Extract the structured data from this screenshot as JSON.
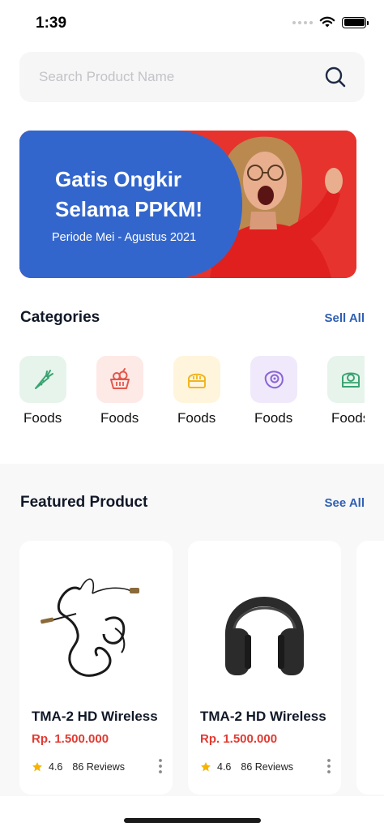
{
  "status_bar": {
    "time": "1:39"
  },
  "search": {
    "placeholder": "Search Product Name"
  },
  "banner": {
    "title": "Gatis Ongkir Selama PPKM!",
    "subtitle": "Periode Mei - Agustus 2021"
  },
  "categories": {
    "title": "Categories",
    "see_all": "Sell All",
    "items": [
      {
        "label": "Foods",
        "icon": "carrot-icon",
        "bg": "#e6f4ec",
        "color": "#3aa371"
      },
      {
        "label": "Foods",
        "icon": "fruit-basket-icon",
        "bg": "#fde9e6",
        "color": "#e5574a"
      },
      {
        "label": "Foods",
        "icon": "bread-icon",
        "bg": "#fff5dc",
        "color": "#f2b51f"
      },
      {
        "label": "Foods",
        "icon": "meat-icon",
        "bg": "#efe9fb",
        "color": "#8a64d6"
      },
      {
        "label": "Foods",
        "icon": "cake-icon",
        "bg": "#e6f4ec",
        "color": "#3aa371"
      }
    ]
  },
  "featured": {
    "title": "Featured Product",
    "see_all": "See All",
    "products": [
      {
        "name": "TMA-2 HD Wireless",
        "price": "Rp. 1.500.000",
        "rating": "4.6",
        "reviews": "86 Reviews",
        "image": "cable-icon"
      },
      {
        "name": "TMA-2 HD Wireless",
        "price": "Rp. 1.500.000",
        "rating": "4.6",
        "reviews": "86 Reviews",
        "image": "headphones-icon"
      }
    ]
  },
  "colors": {
    "accent": "#2f5fb3",
    "price": "#e23a32",
    "banner_blue": "#3366cc",
    "banner_red": "#e6332d",
    "star": "#f5b400"
  }
}
